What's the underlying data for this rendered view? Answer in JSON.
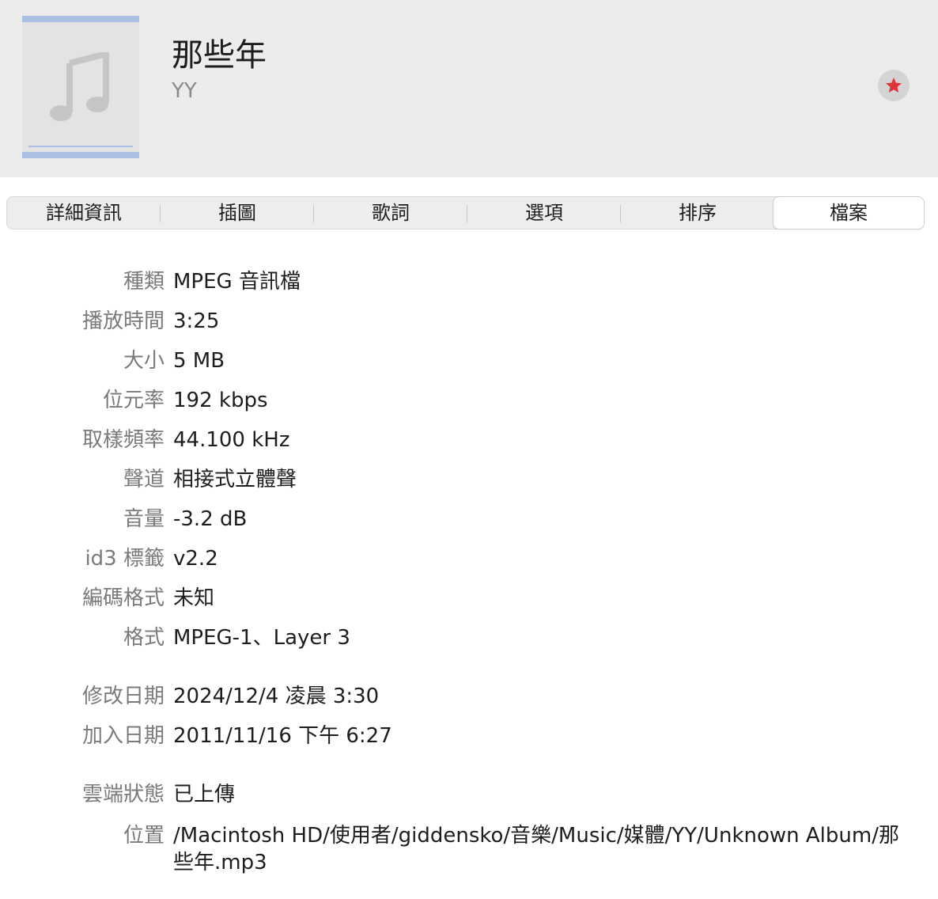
{
  "song": {
    "title": "那些年",
    "artist": "YY"
  },
  "favorite": {
    "icon": "star-icon",
    "color": "#e0343a"
  },
  "tabs": [
    {
      "label": "詳細資訊",
      "selected": false
    },
    {
      "label": "插圖",
      "selected": false
    },
    {
      "label": "歌詞",
      "selected": false
    },
    {
      "label": "選項",
      "selected": false
    },
    {
      "label": "排序",
      "selected": false
    },
    {
      "label": "檔案",
      "selected": true
    }
  ],
  "file_info": [
    {
      "label": "種類",
      "value": "MPEG 音訊檔"
    },
    {
      "label": "播放時間",
      "value": "3:25"
    },
    {
      "label": "大小",
      "value": "5 MB"
    },
    {
      "label": "位元率",
      "value": "192 kbps"
    },
    {
      "label": "取樣頻率",
      "value": "44.100 kHz"
    },
    {
      "label": "聲道",
      "value": "相接式立體聲"
    },
    {
      "label": "音量",
      "value": "-3.2 dB"
    },
    {
      "label": "id3 標籤",
      "value": "v2.2"
    },
    {
      "label": "編碼格式",
      "value": "未知"
    },
    {
      "label": "格式",
      "value": "MPEG-1、Layer 3"
    }
  ],
  "dates": [
    {
      "label": "修改日期",
      "value": "2024/12/4 凌晨 3:30"
    },
    {
      "label": "加入日期",
      "value": "2011/11/16 下午 6:27"
    }
  ],
  "cloud": [
    {
      "label": "雲端狀態",
      "value": "已上傳"
    },
    {
      "label": "位置",
      "value": "/Macintosh HD/使用者/giddensko/音樂/Music/媒體/YY/Unknown Album/那些年.mp3"
    }
  ]
}
